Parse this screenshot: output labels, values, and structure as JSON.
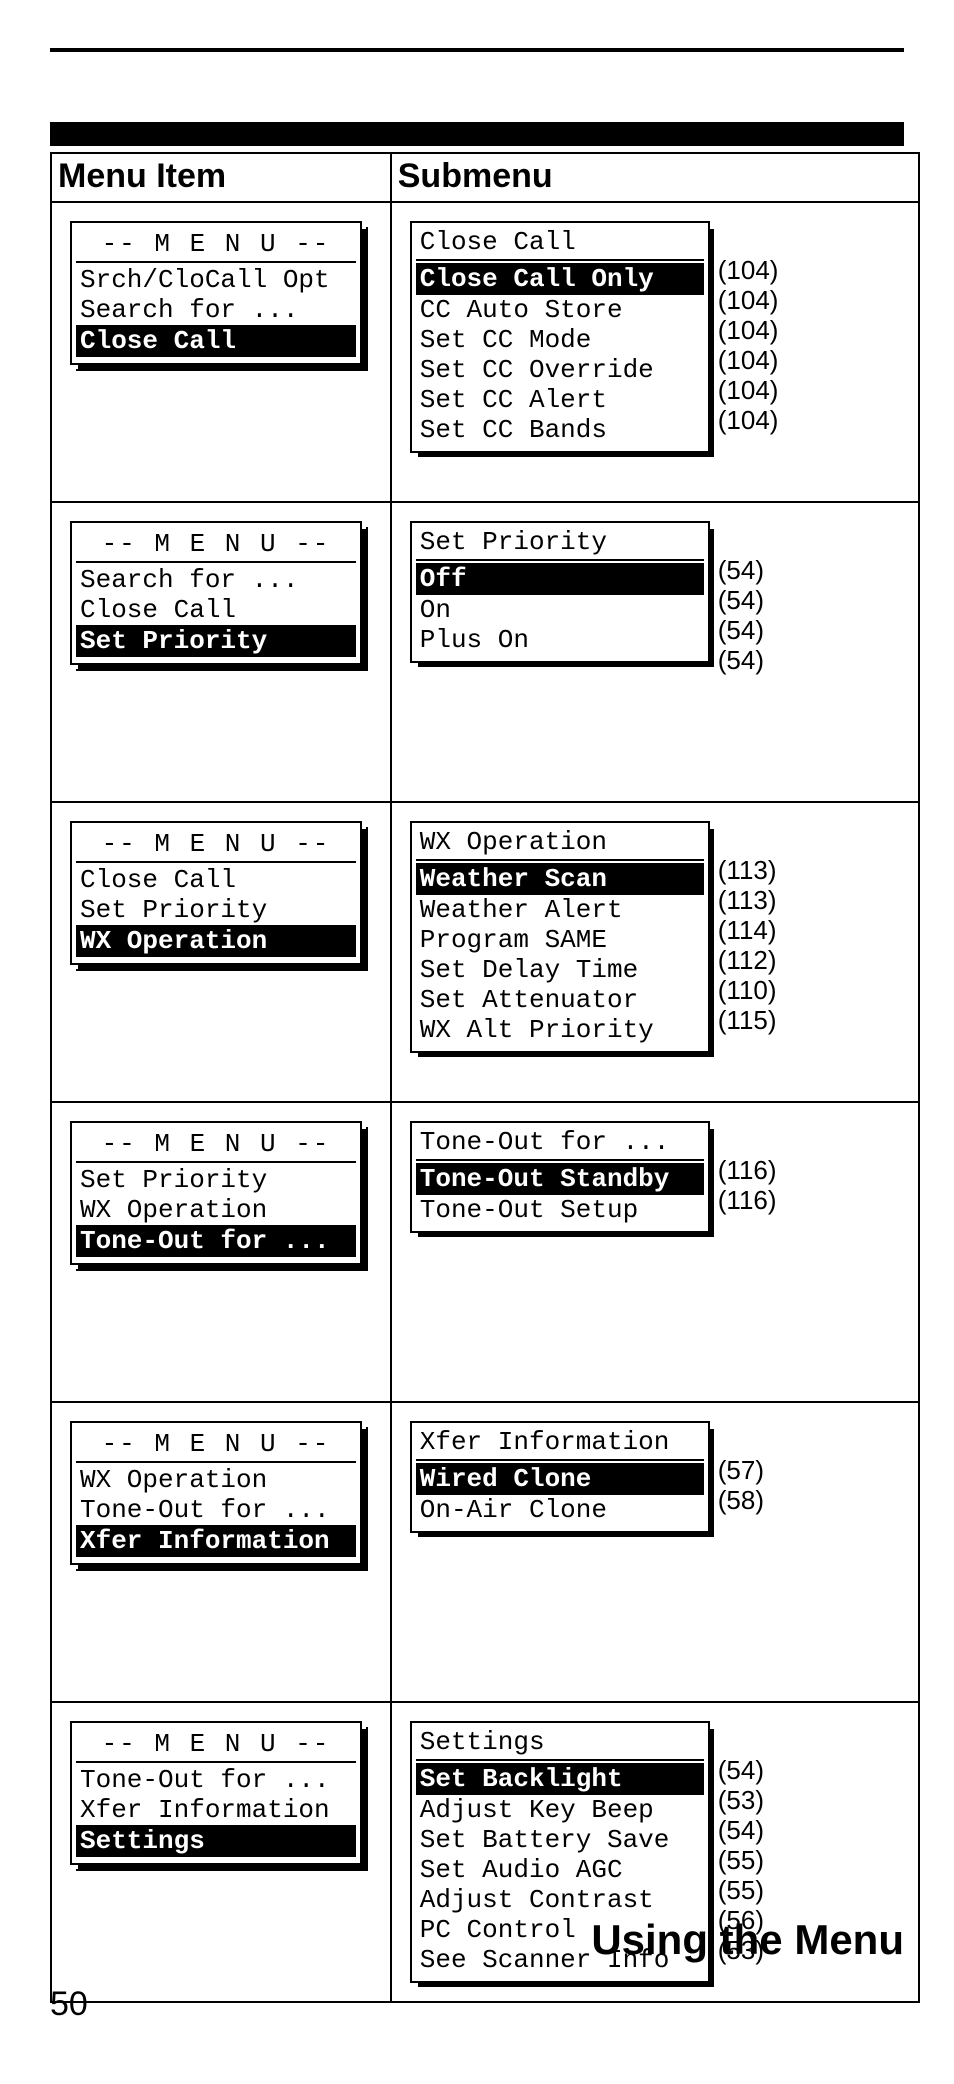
{
  "headers": {
    "menu_item": "Menu Item",
    "submenu": "Submenu"
  },
  "rows": [
    {
      "menu": {
        "title": "-- M E N U --",
        "lines": [
          "Srch/CloCall Opt",
          "Search for ..."
        ],
        "selected": "Close Call"
      },
      "sub": {
        "title": "Close Call",
        "selected": "Close Call Only",
        "lines": [
          "CC Auto Store",
          "Set CC Mode",
          "Set CC Override",
          "Set CC Alert",
          "Set CC Bands"
        ],
        "refs": [
          "(104)",
          "(104)",
          "(104)",
          "(104)",
          "(104)",
          "(104)"
        ]
      }
    },
    {
      "menu": {
        "title": "-- M E N U --",
        "lines": [
          "Search for ...",
          "Close Call"
        ],
        "selected": "Set Priority"
      },
      "sub": {
        "title": "Set Priority",
        "selected": "Off",
        "lines": [
          "On",
          "Plus On"
        ],
        "refs": [
          "(54)",
          "(54)",
          "(54)",
          "(54)"
        ]
      }
    },
    {
      "menu": {
        "title": "-- M E N U --",
        "lines": [
          "Close Call",
          "Set Priority"
        ],
        "selected": "WX Operation"
      },
      "sub": {
        "title": "WX Operation",
        "selected": "Weather Scan",
        "lines": [
          "Weather Alert",
          "Program SAME",
          "Set Delay Time",
          "Set Attenuator",
          "WX Alt Priority"
        ],
        "refs": [
          "(113)",
          "(113)",
          "(114)",
          "(112)",
          "(110)",
          "(115)"
        ]
      }
    },
    {
      "menu": {
        "title": "-- M E N U --",
        "lines": [
          "Set Priority",
          "WX Operation"
        ],
        "selected": "Tone-Out for ..."
      },
      "sub": {
        "title": "Tone-Out for ...",
        "selected": "Tone-Out Standby",
        "lines": [
          "Tone-Out Setup"
        ],
        "refs": [
          "(116)",
          "(116)"
        ]
      }
    },
    {
      "menu": {
        "title": "-- M E N U --",
        "lines": [
          "WX Operation",
          "Tone-Out for ..."
        ],
        "selected": "Xfer Information"
      },
      "sub": {
        "title": "Xfer Information",
        "selected": "Wired Clone",
        "lines": [
          "On-Air Clone"
        ],
        "refs": [
          "(57)",
          "(58)"
        ]
      }
    },
    {
      "menu": {
        "title": "-- M E N U --",
        "lines": [
          "Tone-Out for ...",
          "Xfer Information"
        ],
        "selected": "Settings"
      },
      "sub": {
        "title": "Settings",
        "selected": "Set Backlight",
        "lines": [
          "Adjust Key Beep",
          "Set Battery Save",
          "Set Audio AGC",
          "Adjust Contrast",
          "PC Control",
          "See Scanner Info"
        ],
        "refs": [
          "(54)",
          "(53)",
          "(54)",
          "(55)",
          "(55)",
          "(56)",
          "(53)"
        ]
      }
    }
  ],
  "footer": {
    "section_title": "Using the Menu",
    "page_number": "50"
  }
}
